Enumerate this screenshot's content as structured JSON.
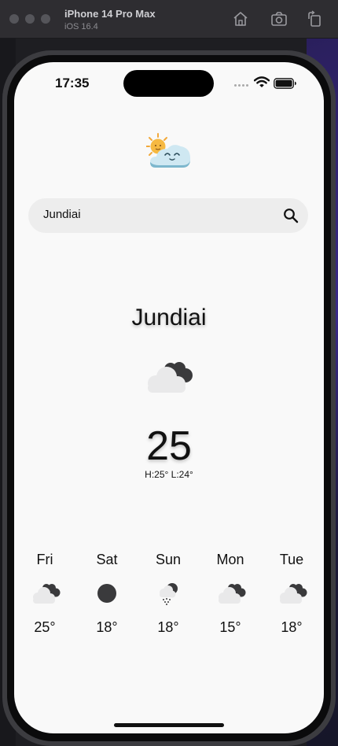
{
  "window": {
    "device_title": "iPhone 14 Pro Max",
    "os_version": "iOS 16.4",
    "toolbar_icons": [
      "home-icon",
      "screenshot-icon",
      "rotate-icon"
    ]
  },
  "status_bar": {
    "time": "17:35",
    "icons": [
      "signal-dots-icon",
      "wifi-icon",
      "battery-icon"
    ]
  },
  "app": {
    "logo_icon": "sun-behind-cloud-logo-icon"
  },
  "search": {
    "value": "Jundiai",
    "icon": "search-icon"
  },
  "current": {
    "city": "Jundiai",
    "icon": "cloudy-night-icon",
    "temperature": "25",
    "high_low": "H:25° L:24°"
  },
  "forecast": [
    {
      "day": "Fri",
      "icon": "cloudy-night-icon",
      "temp": "25°"
    },
    {
      "day": "Sat",
      "icon": "moon-icon",
      "temp": "18°"
    },
    {
      "day": "Sun",
      "icon": "snow-night-icon",
      "temp": "18°"
    },
    {
      "day": "Mon",
      "icon": "cloudy-night-icon",
      "temp": "15°"
    },
    {
      "day": "Tue",
      "icon": "cloudy-night-icon",
      "temp": "18°"
    }
  ],
  "colors": {
    "screen_background": "#f9f9f9",
    "search_background": "#ededed",
    "text": "#111111",
    "icon_dark": "#3a3a3c",
    "icon_cloud": "#e9e9ea"
  }
}
